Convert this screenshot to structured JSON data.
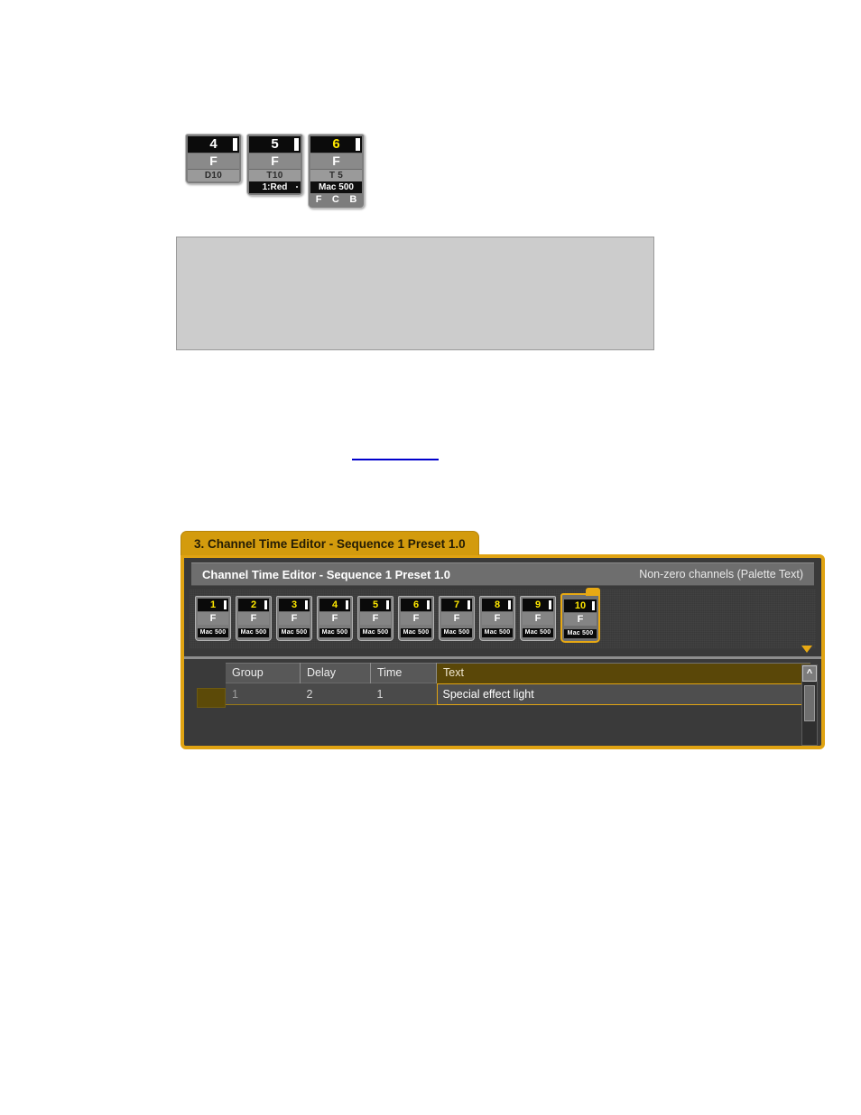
{
  "fixtures": [
    {
      "number": "4",
      "number_color": "white",
      "mode": "F",
      "lines": [
        {
          "style": "light",
          "text": "D10"
        }
      ]
    },
    {
      "number": "5",
      "number_color": "white",
      "mode": "F",
      "lines": [
        {
          "style": "light",
          "text": "T10"
        },
        {
          "style": "dark",
          "text": "1:Red"
        }
      ]
    },
    {
      "number": "6",
      "number_color": "yellow",
      "mode": "F",
      "lines": [
        {
          "style": "light",
          "text": "T 5"
        },
        {
          "style": "dark",
          "text": "Mac 500"
        }
      ],
      "attributes": [
        "F",
        "C",
        "B"
      ]
    }
  ],
  "window": {
    "tab_label": "3. Channel Time Editor - Sequence 1 Preset 1.0",
    "header_title": "Channel Time Editor - Sequence 1 Preset 1.0",
    "header_status": "Non-zero channels (Palette Text)"
  },
  "channels": [
    {
      "number": "1",
      "mode": "F",
      "name": "Mac 500",
      "selected": false
    },
    {
      "number": "2",
      "mode": "F",
      "name": "Mac 500",
      "selected": false
    },
    {
      "number": "3",
      "mode": "F",
      "name": "Mac 500",
      "selected": false
    },
    {
      "number": "4",
      "mode": "F",
      "name": "Mac 500",
      "selected": false
    },
    {
      "number": "5",
      "mode": "F",
      "name": "Mac 500",
      "selected": false
    },
    {
      "number": "6",
      "mode": "F",
      "name": "Mac 500",
      "selected": false
    },
    {
      "number": "7",
      "mode": "F",
      "name": "Mac 500",
      "selected": false
    },
    {
      "number": "8",
      "mode": "F",
      "name": "Mac 500",
      "selected": false
    },
    {
      "number": "9",
      "mode": "F",
      "name": "Mac 500",
      "selected": false
    },
    {
      "number": "10",
      "mode": "F",
      "name": "Mac 500",
      "selected": true
    }
  ],
  "table": {
    "columns": [
      "Group",
      "Delay",
      "Time",
      "Text"
    ],
    "rows": [
      {
        "group": "1",
        "delay": "2",
        "time": "1",
        "text": "Special effect light"
      }
    ]
  },
  "scrollbar": {
    "up_arrow": "^"
  },
  "colors": {
    "accent_amber": "#e0a312",
    "tab_gold": "#d39b0d",
    "channel_number_yellow": "#ffe800",
    "panel_dark": "#3a3a3a",
    "header_grey": "#6e6e6e",
    "link_blue": "#0000cc",
    "grey_box": "#cccccc"
  }
}
